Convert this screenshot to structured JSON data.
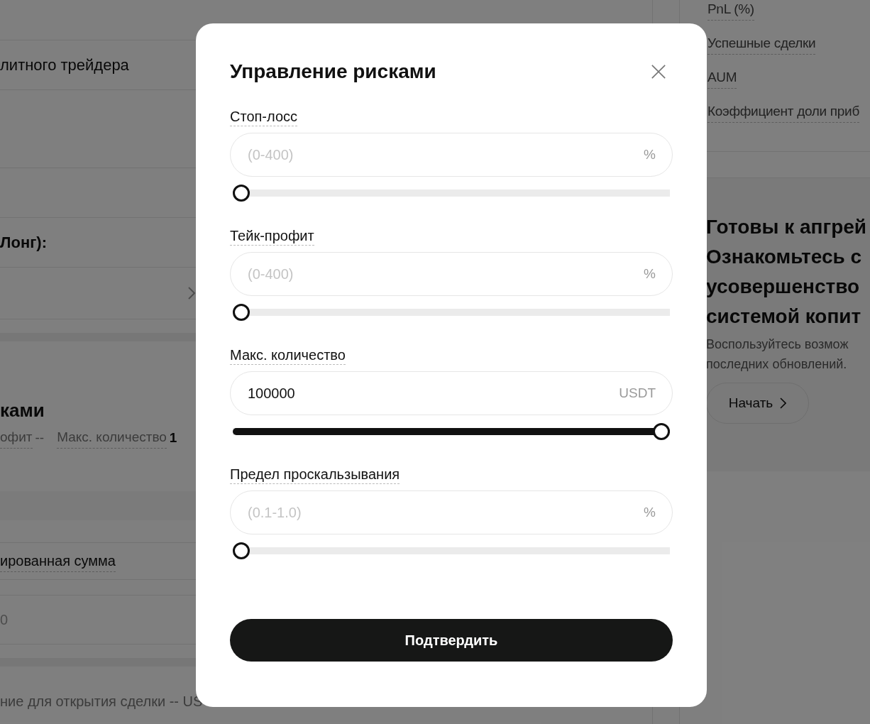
{
  "background": {
    "left_rows": [
      {
        "kind": "text",
        "text": "литного трейдера"
      },
      {
        "kind": "bold",
        "text": "Лонг):"
      },
      {
        "kind": "chevron"
      }
    ],
    "risk_section": {
      "heading": "ками",
      "items": [
        {
          "label": "офит",
          "value": "--"
        },
        {
          "label": "Макс. количество",
          "value": "1"
        }
      ]
    },
    "amount_label": "ированная сумма",
    "amount_value": "0",
    "footer_text": "ние для открытия сделки -- US",
    "stats": [
      "PnL (%)",
      "Успешные сделки",
      "AUM",
      "Коэффициент доли приб"
    ],
    "promo": {
      "heading_lines": [
        "Готовы к апгрей",
        "Ознакомьтесь с",
        "усовершенство",
        "системой копит"
      ],
      "text_lines": [
        "Воспользуйтесь возмож",
        "последних обновлений."
      ],
      "button": "Начать"
    }
  },
  "dialog": {
    "title": "Управление рисками",
    "fields": [
      {
        "label": "Стоп-лосс",
        "placeholder": "(0-400)",
        "unit": "%",
        "level": 0
      },
      {
        "label": "Тейк-профит",
        "placeholder": "(0-400)",
        "unit": "%",
        "level": 0
      },
      {
        "label": "Макс. количество",
        "value": "100000",
        "unit": "USDT",
        "level": 1
      },
      {
        "label": "Предел проскальзывания",
        "placeholder": "(0.1-1.0)",
        "unit": "%",
        "level": 0
      }
    ],
    "confirm": "Подтвердить"
  }
}
